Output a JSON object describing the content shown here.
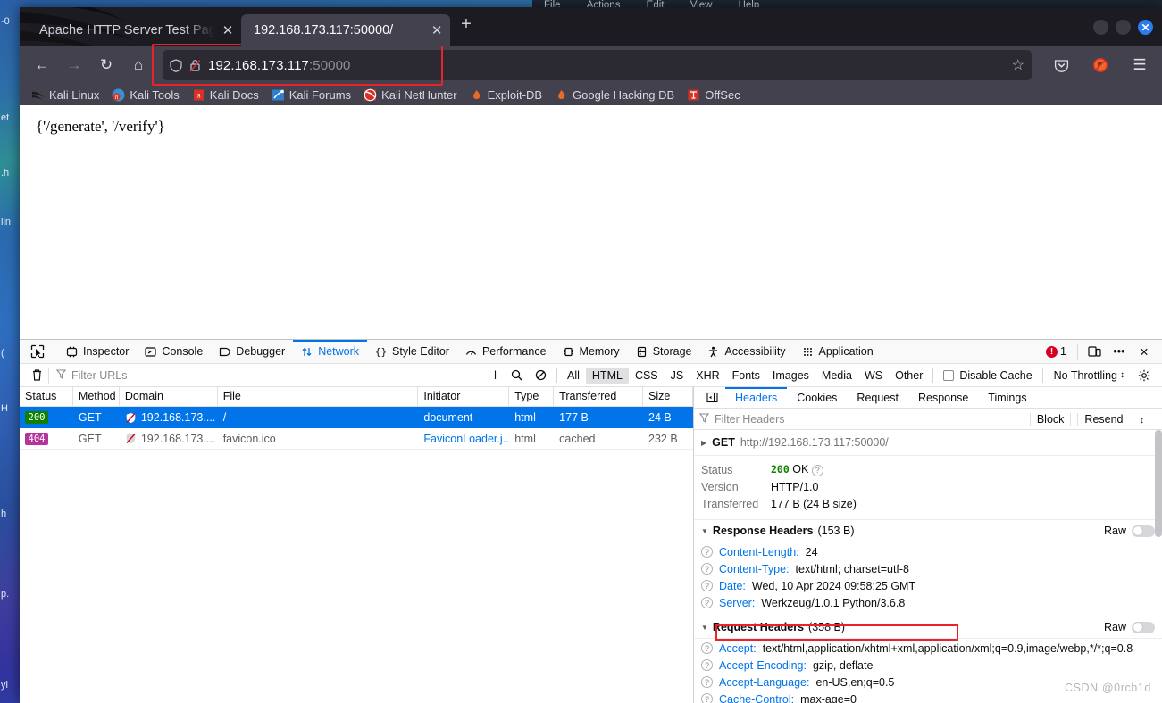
{
  "desktop": {
    "back_window_menu": [
      "File",
      "Actions",
      "Edit",
      "View",
      "Help"
    ],
    "left_edge_fragments": [
      "-0",
      "et",
      ".h",
      "lin",
      "(",
      "H",
      "h",
      "p.",
      "yl"
    ]
  },
  "browser": {
    "tabs": [
      {
        "title": "Apache HTTP Server Test Pag",
        "close": "✕",
        "active": false
      },
      {
        "title": "192.168.173.117:50000/",
        "close": "✕",
        "active": true
      }
    ],
    "new_tab_label": "+",
    "window_controls": {
      "minimize": "",
      "maximize": "",
      "close": "✕"
    },
    "nav": {
      "back": "←",
      "forward": "→",
      "reload": "↻",
      "home": "⌂",
      "url_text": "192.168.173.117",
      "url_port": ":50000",
      "shield_icon": "shield-icon",
      "lock_icon": "lock-broken-icon",
      "bookmark_star": "☆",
      "pocket_icon": "pocket-icon",
      "noscript_icon": "noscript-icon",
      "menu_icon": "☰"
    },
    "bookmarks": [
      {
        "label": "Kali Linux",
        "icon": "kali-dragon-icon"
      },
      {
        "label": "Kali Tools",
        "icon": "kali-tools-icon"
      },
      {
        "label": "Kali Docs",
        "icon": "kali-docs-icon"
      },
      {
        "label": "Kali Forums",
        "icon": "kali-forums-icon"
      },
      {
        "label": "Kali NetHunter",
        "icon": "kali-nethunter-icon"
      },
      {
        "label": "Exploit-DB",
        "icon": "exploitdb-icon"
      },
      {
        "label": "Google Hacking DB",
        "icon": "google-hacking-db-icon"
      },
      {
        "label": "OffSec",
        "icon": "offsec-icon"
      }
    ],
    "page_content": "{'/generate', '/verify'}"
  },
  "devtools": {
    "picker_icon": "element-picker-icon",
    "tabs": [
      {
        "label": "Inspector",
        "icon": "inspector-icon",
        "active": false
      },
      {
        "label": "Console",
        "icon": "console-icon",
        "active": false
      },
      {
        "label": "Debugger",
        "icon": "debugger-icon",
        "active": false
      },
      {
        "label": "Network",
        "icon": "network-icon",
        "active": true
      },
      {
        "label": "Style Editor",
        "icon": "style-editor-icon",
        "active": false
      },
      {
        "label": "Performance",
        "icon": "performance-icon",
        "active": false
      },
      {
        "label": "Memory",
        "icon": "memory-icon",
        "active": false
      },
      {
        "label": "Storage",
        "icon": "storage-icon",
        "active": false
      },
      {
        "label": "Accessibility",
        "icon": "accessibility-icon",
        "active": false
      },
      {
        "label": "Application",
        "icon": "application-icon",
        "active": false
      }
    ],
    "error_count": "1",
    "responsive_mode_icon": "responsive-design-mode-icon",
    "more_tools_icon": "•••",
    "close_icon": "✕",
    "network_toolbar": {
      "clear_icon": "trash-icon",
      "filter_placeholder": "Filter URLs",
      "filter_icon": "funnel-icon",
      "pause_icon": "‖",
      "search_icon": "search-icon",
      "block_icon": "no-entry-icon",
      "type_filters": [
        "All",
        "HTML",
        "CSS",
        "JS",
        "XHR",
        "Fonts",
        "Images",
        "Media",
        "WS",
        "Other"
      ],
      "selected_type_filter": "HTML",
      "disable_cache_label": "Disable Cache",
      "disable_cache_checked": false,
      "throttling_label": "No Throttling",
      "settings_icon": "gear-icon"
    },
    "columns": [
      "Status",
      "Method",
      "Domain",
      "File",
      "Initiator",
      "Type",
      "Transferred",
      "Size"
    ],
    "requests": [
      {
        "status": "200",
        "status_class": "st200",
        "method": "GET",
        "domain": "192.168.173....",
        "file": "/",
        "initiator": "document",
        "type": "html",
        "transferred": "177 B",
        "size": "24 B",
        "selected": true
      },
      {
        "status": "404",
        "status_class": "st404",
        "method": "GET",
        "domain": "192.168.173....",
        "file": "favicon.ico",
        "initiator": "FaviconLoader.j...",
        "type": "html",
        "transferred": "cached",
        "size": "232 B",
        "selected": false
      }
    ],
    "details": {
      "panel_tabs": [
        "Headers",
        "Cookies",
        "Request",
        "Response",
        "Timings"
      ],
      "active_panel_tab": "Headers",
      "filter_placeholder": "Filter Headers",
      "block_label": "Block",
      "resend_label": "Resend",
      "request_method": "GET",
      "request_url": "http://192.168.173.117:50000/",
      "summary": [
        {
          "key": "Status",
          "value": "200",
          "suffix": "OK",
          "is_status": true
        },
        {
          "key": "Version",
          "value": "HTTP/1.0"
        },
        {
          "key": "Transferred",
          "value": "177 B (24 B size)"
        }
      ],
      "response_headers_title": "Response Headers",
      "response_headers_size": "(153 B)",
      "raw_label": "Raw",
      "response_headers": [
        {
          "name": "Content-Length:",
          "value": "24"
        },
        {
          "name": "Content-Type:",
          "value": "text/html; charset=utf-8"
        },
        {
          "name": "Date:",
          "value": "Wed, 10 Apr 2024 09:58:25 GMT"
        },
        {
          "name": "Server:",
          "value": "Werkzeug/1.0.1 Python/3.6.8",
          "highlighted": true
        }
      ],
      "request_headers_title": "Request Headers",
      "request_headers_size": "(358 B)",
      "request_headers": [
        {
          "name": "Accept:",
          "value": "text/html,application/xhtml+xml,application/xml;q=0.9,image/webp,*/*;q=0.8"
        },
        {
          "name": "Accept-Encoding:",
          "value": "gzip, deflate"
        },
        {
          "name": "Accept-Language:",
          "value": "en-US,en;q=0.5"
        },
        {
          "name": "Cache-Control:",
          "value": "max-age=0"
        }
      ]
    },
    "watermark": "CSDN @0rch1d"
  }
}
